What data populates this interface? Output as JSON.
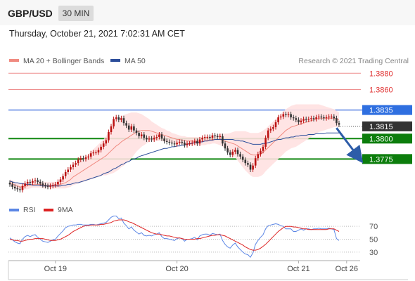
{
  "header": {
    "symbol": "GBP/USD",
    "timeframe": "30 MIN",
    "datetime": "Thursday, October 21, 2021 7:02:31 AM CET"
  },
  "colors": {
    "candle_up": "#bb1111",
    "candle_down": "#333333",
    "ma20": "#f08a80",
    "ma50": "#2b4d9a",
    "bands_fill": "#ffe1e1",
    "resistance": "#e03030",
    "pivot": "#3366dd",
    "support": "#118811",
    "arrow": "#2d5ca8",
    "rsi": "#5b86e5",
    "rsi_ma": "#dd2222",
    "grid_dotted": "#bbbbbb"
  },
  "chart_data": [
    {
      "type": "candlestick",
      "legend": [
        {
          "name": "MA 20 + Bollinger Bands",
          "color": "#f08a80"
        },
        {
          "name": "MA 50",
          "color": "#2b4d9a"
        }
      ],
      "watermark": "Research © 2021 Trading Central",
      "x_ticks": [
        {
          "label": "Oct 19",
          "index": 18
        },
        {
          "label": "Oct 20",
          "index": 66
        },
        {
          "label": "Oct 21",
          "index": 114
        },
        {
          "label": "Oct 26",
          "index": 133
        }
      ],
      "ylim": [
        1.3728,
        1.3888
      ],
      "levels": [
        {
          "label": "1.3880",
          "value": 1.388,
          "kind": "resistance"
        },
        {
          "label": "1.3860",
          "value": 1.386,
          "kind": "resistance"
        },
        {
          "label": "1.3835",
          "value": 1.3835,
          "kind": "pivot"
        },
        {
          "label": "1.3815",
          "value": 1.3815,
          "kind": "current"
        },
        {
          "label": "1.3800",
          "value": 1.38,
          "kind": "support"
        },
        {
          "label": "1.3775",
          "value": 1.3775,
          "kind": "support"
        }
      ],
      "forecast_arrow": {
        "from": {
          "index": 129,
          "value": 1.3813
        },
        "to": {
          "index": 138,
          "value": 1.3776
        }
      },
      "close": [
        1.3744,
        1.3741,
        1.3739,
        1.3738,
        1.3737,
        1.3742,
        1.3745,
        1.3747,
        1.3746,
        1.3748,
        1.3749,
        1.3747,
        1.3745,
        1.3743,
        1.3742,
        1.3741,
        1.3742,
        1.3743,
        1.3744,
        1.3747,
        1.375,
        1.3754,
        1.3759,
        1.3762,
        1.3765,
        1.3768,
        1.377,
        1.3774,
        1.3776,
        1.3775,
        1.3777,
        1.3778,
        1.3782,
        1.3783,
        1.3783,
        1.3786,
        1.379,
        1.3794,
        1.3798,
        1.3808,
        1.3815,
        1.3824,
        1.3826,
        1.3823,
        1.3825,
        1.3819,
        1.3816,
        1.3811,
        1.3815,
        1.381,
        1.3807,
        1.3803,
        1.3805,
        1.3801,
        1.3799,
        1.38,
        1.3799,
        1.3801,
        1.3802,
        1.3805,
        1.38,
        1.3797,
        1.3796,
        1.3795,
        1.3794,
        1.3793,
        1.3795,
        1.3796,
        1.3795,
        1.3792,
        1.3794,
        1.3794,
        1.3795,
        1.3797,
        1.3794,
        1.3799,
        1.3801,
        1.3802,
        1.3802,
        1.3801,
        1.3804,
        1.3803,
        1.3802,
        1.3803,
        1.3794,
        1.3788,
        1.3783,
        1.378,
        1.3784,
        1.3786,
        1.3781,
        1.3778,
        1.3774,
        1.377,
        1.3768,
        1.3762,
        1.3767,
        1.3776,
        1.3781,
        1.3785,
        1.379,
        1.3801,
        1.381,
        1.3812,
        1.3814,
        1.382,
        1.3826,
        1.3827,
        1.383,
        1.3829,
        1.383,
        1.3826,
        1.3825,
        1.3823,
        1.382,
        1.3822,
        1.3824,
        1.3823,
        1.3824,
        1.3825,
        1.3824,
        1.3826,
        1.3827,
        1.3826,
        1.3825,
        1.3826,
        1.3827,
        1.3827,
        1.3825,
        1.3819,
        1.3817
      ],
      "ma20": [
        1.3746,
        1.3745,
        1.3743,
        1.3742,
        1.3741,
        1.3741,
        1.3742,
        1.3742,
        1.3743,
        1.3744,
        1.3744,
        1.3744,
        1.3744,
        1.3743,
        1.3743,
        1.3743,
        1.3743,
        1.3743,
        1.3743,
        1.3743,
        1.3744,
        1.3745,
        1.3746,
        1.3748,
        1.375,
        1.3753,
        1.3755,
        1.3757,
        1.3759,
        1.3761,
        1.3763,
        1.3765,
        1.3767,
        1.3769,
        1.3771,
        1.3773,
        1.3775,
        1.3777,
        1.3779,
        1.3782,
        1.3785,
        1.3788,
        1.3791,
        1.3793,
        1.3796,
        1.3798,
        1.38,
        1.3802,
        1.3804,
        1.3806,
        1.3808,
        1.3809,
        1.381,
        1.381,
        1.381,
        1.381,
        1.3809,
        1.3808,
        1.3807,
        1.3806,
        1.3805,
        1.3804,
        1.3803,
        1.3802,
        1.3801,
        1.38,
        1.3799,
        1.3799,
        1.3798,
        1.3798,
        1.3797,
        1.3797,
        1.3797,
        1.3797,
        1.3797,
        1.3797,
        1.3797,
        1.3797,
        1.3798,
        1.3798,
        1.3799,
        1.3799,
        1.3799,
        1.3799,
        1.3798,
        1.3797,
        1.3796,
        1.3795,
        1.3794,
        1.3793,
        1.3791,
        1.3789,
        1.3787,
        1.3785,
        1.3783,
        1.3781,
        1.378,
        1.378,
        1.378,
        1.3781,
        1.3783,
        1.3786,
        1.3789,
        1.3792,
        1.3795,
        1.3798,
        1.3801,
        1.3804,
        1.3807,
        1.381,
        1.3812,
        1.3814,
        1.3815,
        1.3816,
        1.3817,
        1.3818,
        1.3819,
        1.382,
        1.3821,
        1.3822,
        1.3823,
        1.3824,
        1.3825,
        1.3825,
        1.3825,
        1.3825,
        1.3825,
        1.3825,
        1.3825,
        1.3824,
        1.3823
      ],
      "ma50": [
        1.3748,
        1.3747,
        1.3746,
        1.3746,
        1.3745,
        1.3745,
        1.3744,
        1.3744,
        1.3744,
        1.3743,
        1.3743,
        1.3743,
        1.3743,
        1.3742,
        1.3742,
        1.3742,
        1.3742,
        1.3742,
        1.3742,
        1.3742,
        1.3742,
        1.3743,
        1.3743,
        1.3744,
        1.3744,
        1.3745,
        1.3746,
        1.3746,
        1.3747,
        1.3748,
        1.3749,
        1.375,
        1.3751,
        1.3752,
        1.3753,
        1.3754,
        1.3755,
        1.3757,
        1.3758,
        1.3759,
        1.3761,
        1.3763,
        1.3764,
        1.3766,
        1.3768,
        1.3769,
        1.3771,
        1.3772,
        1.3774,
        1.3775,
        1.3776,
        1.3778,
        1.3779,
        1.378,
        1.3781,
        1.3782,
        1.3783,
        1.3784,
        1.3785,
        1.3786,
        1.3787,
        1.3788,
        1.3788,
        1.3789,
        1.379,
        1.379,
        1.3791,
        1.3791,
        1.3792,
        1.3792,
        1.3793,
        1.3794,
        1.3794,
        1.3795,
        1.3795,
        1.3796,
        1.3796,
        1.3797,
        1.3797,
        1.3798,
        1.3798,
        1.3799,
        1.3799,
        1.3799,
        1.3799,
        1.3799,
        1.3799,
        1.3799,
        1.3799,
        1.3798,
        1.3798,
        1.3797,
        1.3797,
        1.3796,
        1.3795,
        1.3794,
        1.3793,
        1.3793,
        1.3793,
        1.3793,
        1.3794,
        1.3794,
        1.3795,
        1.3796,
        1.3797,
        1.3798,
        1.3799,
        1.3799,
        1.38,
        1.3801,
        1.3801,
        1.3802,
        1.3802,
        1.3803,
        1.3803,
        1.3804,
        1.3804,
        1.3804,
        1.3805,
        1.3805,
        1.3805,
        1.3806,
        1.3806,
        1.3806,
        1.3806,
        1.3807,
        1.3807,
        1.3807,
        1.3807,
        1.3807,
        1.3807
      ],
      "bb_width": [
        0.0004,
        0.0004,
        0.0004,
        0.0004,
        0.0004,
        0.0004,
        0.0004,
        0.0004,
        0.0004,
        0.0004,
        0.0004,
        0.0004,
        0.0004,
        0.0004,
        0.0004,
        0.0004,
        0.0004,
        0.0004,
        0.0004,
        0.0004,
        0.0005,
        0.0006,
        0.0007,
        0.0008,
        0.0009,
        0.001,
        0.0011,
        0.0012,
        0.0013,
        0.0014,
        0.0015,
        0.0016,
        0.0017,
        0.0018,
        0.0019,
        0.002,
        0.0021,
        0.0022,
        0.0024,
        0.0026,
        0.0028,
        0.003,
        0.0031,
        0.0031,
        0.0031,
        0.0031,
        0.003,
        0.0029,
        0.0028,
        0.0026,
        0.0024,
        0.0022,
        0.002,
        0.0018,
        0.0016,
        0.0014,
        0.0012,
        0.0011,
        0.001,
        0.0009,
        0.0008,
        0.0008,
        0.0007,
        0.0007,
        0.0006,
        0.0006,
        0.0006,
        0.0005,
        0.0005,
        0.0005,
        0.0005,
        0.0005,
        0.0005,
        0.0005,
        0.0005,
        0.0005,
        0.0005,
        0.0005,
        0.0005,
        0.0005,
        0.0005,
        0.0005,
        0.0006,
        0.0007,
        0.0008,
        0.0009,
        0.001,
        0.0012,
        0.0014,
        0.0016,
        0.0018,
        0.002,
        0.0022,
        0.0024,
        0.0025,
        0.0026,
        0.0027,
        0.0027,
        0.0027,
        0.0027,
        0.0027,
        0.0026,
        0.0026,
        0.0026,
        0.0026,
        0.0026,
        0.0026,
        0.0026,
        0.0026,
        0.0026,
        0.0026,
        0.0026,
        0.0026,
        0.0026,
        0.0025,
        0.0024,
        0.0023,
        0.0022,
        0.0021,
        0.002,
        0.0019,
        0.0018,
        0.0017,
        0.0016,
        0.0015,
        0.0014,
        0.0013,
        0.0012,
        0.0011,
        0.001,
        0.0009,
        0.0008,
        0.0008
      ],
      "rsi_panel": {
        "legend": [
          {
            "name": "RSI",
            "color": "#5b86e5"
          },
          {
            "name": "9MA",
            "color": "#dd2222"
          }
        ],
        "ylim": [
          20,
          80
        ],
        "levels": [
          70,
          50,
          30
        ],
        "level_labels": [
          "70",
          "50",
          "30"
        ],
        "rsi": [
          52,
          49,
          46,
          44,
          43,
          50,
          54,
          56,
          54,
          56,
          57,
          53,
          50,
          47,
          46,
          45,
          47,
          49,
          50,
          55,
          59,
          63,
          68,
          70,
          71,
          72,
          72,
          73,
          73,
          72,
          72,
          72,
          73,
          73,
          72,
          73,
          74,
          75,
          76,
          80,
          84,
          86,
          86,
          82,
          83,
          75,
          71,
          66,
          69,
          64,
          61,
          58,
          60,
          56,
          55,
          56,
          55,
          57,
          58,
          60,
          54,
          51,
          51,
          50,
          49,
          48,
          51,
          52,
          51,
          47,
          50,
          50,
          51,
          53,
          49,
          55,
          57,
          58,
          58,
          56,
          59,
          58,
          57,
          58,
          48,
          42,
          38,
          36,
          41,
          44,
          38,
          34,
          30,
          27,
          26,
          22,
          29,
          42,
          48,
          53,
          57,
          66,
          71,
          72,
          73,
          74,
          73,
          71,
          70,
          66,
          66,
          66,
          62,
          62,
          64,
          66,
          64,
          66,
          66,
          65,
          66,
          66,
          67,
          66,
          66,
          66,
          67,
          66,
          65,
          51,
          48
        ],
        "rsi_ma": [
          50,
          49,
          48,
          48,
          47,
          47,
          48,
          49,
          50,
          50,
          51,
          51,
          51,
          51,
          50,
          49,
          48,
          48,
          48,
          49,
          50,
          52,
          54,
          56,
          59,
          62,
          64,
          66,
          68,
          70,
          71,
          71,
          72,
          72,
          72,
          72,
          73,
          73,
          74,
          75,
          76,
          78,
          79,
          80,
          80,
          80,
          79,
          77,
          76,
          74,
          72,
          70,
          68,
          66,
          64,
          62,
          60,
          59,
          58,
          58,
          57,
          56,
          55,
          55,
          54,
          53,
          52,
          52,
          51,
          50,
          50,
          50,
          50,
          50,
          51,
          51,
          52,
          53,
          54,
          55,
          56,
          56,
          57,
          57,
          56,
          55,
          53,
          51,
          49,
          47,
          45,
          43,
          41,
          38,
          36,
          34,
          33,
          33,
          34,
          36,
          39,
          42,
          46,
          50,
          54,
          58,
          62,
          65,
          68,
          70,
          70,
          70,
          69,
          69,
          68,
          67,
          66,
          66,
          65,
          65,
          65,
          65,
          65,
          65,
          65,
          65,
          66,
          66,
          66,
          64,
          62
        ]
      }
    }
  ]
}
